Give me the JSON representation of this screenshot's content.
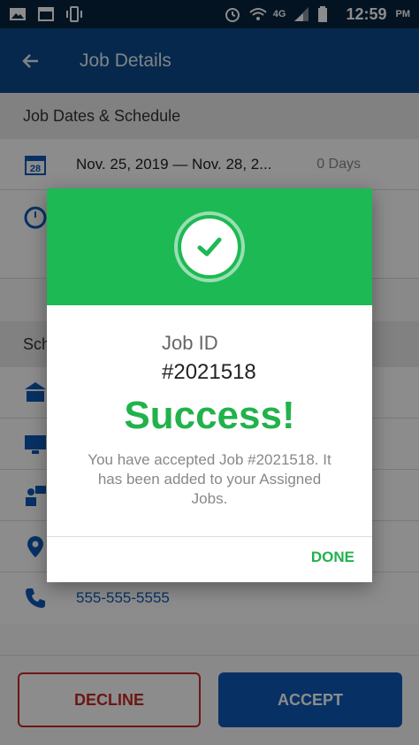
{
  "status_bar": {
    "time": "12:59",
    "ampm": "PM",
    "network": "4G",
    "icons": [
      "image-icon",
      "calendar-icon",
      "vibrate-icon",
      "alarm-icon",
      "wifi-icon",
      "signal-icon",
      "battery-icon"
    ]
  },
  "app_bar": {
    "title": "Job Details"
  },
  "schedule": {
    "header": "Job Dates & Schedule",
    "date_range": "Nov. 25, 2019 — Nov. 28, 2...",
    "duration": "0 Days",
    "calendar_day": "28"
  },
  "school": {
    "header_partial": "Sch",
    "phone": "555-555-5555"
  },
  "actions": {
    "decline": "DECLINE",
    "accept": "ACCEPT"
  },
  "dialog": {
    "job_id_label": "Job ID",
    "job_id_value": "#2021518",
    "title": "Success!",
    "message": "You have accepted Job #2021518. It has been added to your Assigned Jobs.",
    "done": "DONE"
  },
  "colors": {
    "app_bar": "#0c4a8a",
    "success_green": "#1db954",
    "decline_red": "#c62828",
    "accept_blue": "#0d59b6"
  }
}
